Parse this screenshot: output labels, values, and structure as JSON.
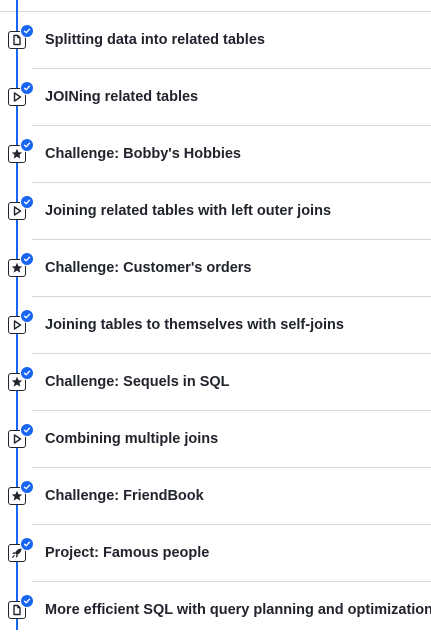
{
  "lessons": [
    {
      "type": "article",
      "icon": "article-icon",
      "completed": true,
      "title": "Splitting data into related tables"
    },
    {
      "type": "video",
      "icon": "video-play-icon",
      "completed": true,
      "title": "JOINing related tables"
    },
    {
      "type": "challenge",
      "icon": "star-icon",
      "completed": true,
      "title": "Challenge: Bobby's Hobbies"
    },
    {
      "type": "video",
      "icon": "video-play-icon",
      "completed": true,
      "title": "Joining related tables with left outer joins"
    },
    {
      "type": "challenge",
      "icon": "star-icon",
      "completed": true,
      "title": "Challenge: Customer's orders"
    },
    {
      "type": "video",
      "icon": "video-play-icon",
      "completed": true,
      "title": "Joining tables to themselves with self-joins"
    },
    {
      "type": "challenge",
      "icon": "star-icon",
      "completed": true,
      "title": "Challenge: Sequels in SQL"
    },
    {
      "type": "video",
      "icon": "video-play-icon",
      "completed": true,
      "title": "Combining multiple joins"
    },
    {
      "type": "challenge",
      "icon": "star-icon",
      "completed": true,
      "title": "Challenge: FriendBook"
    },
    {
      "type": "project",
      "icon": "rocket-icon",
      "completed": true,
      "title": "Project: Famous people"
    },
    {
      "type": "article",
      "icon": "article-icon",
      "completed": true,
      "title": "More efficient SQL with query planning and optimization"
    }
  ],
  "colors": {
    "accent": "#1865f2",
    "text": "#21242c",
    "divider": "#d6d8da"
  }
}
